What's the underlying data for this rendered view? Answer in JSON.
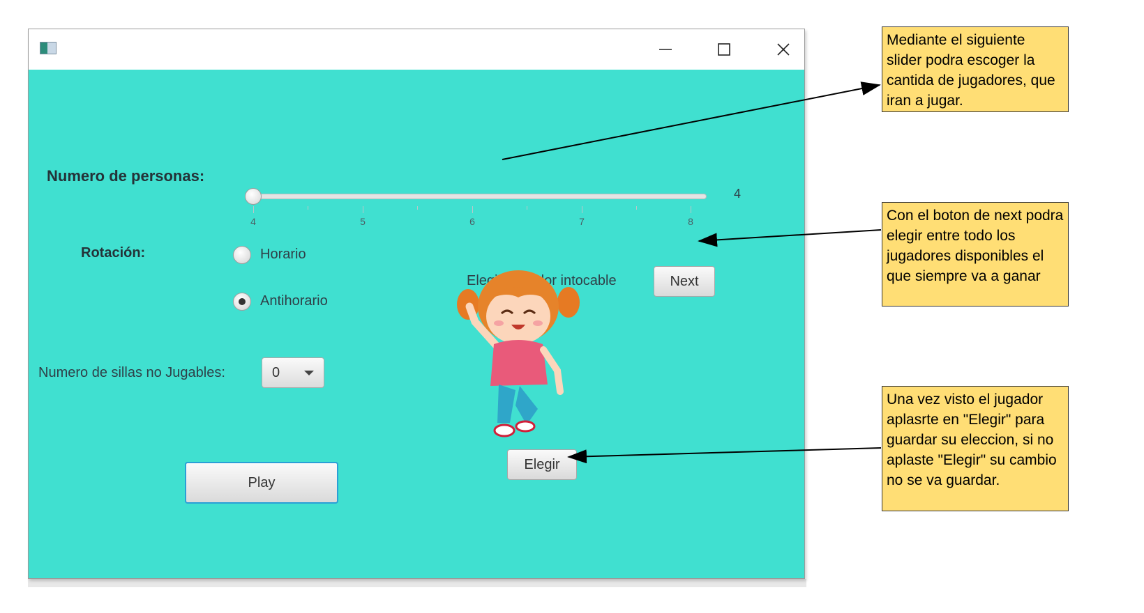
{
  "window": {
    "icon": "app-icon",
    "controls": [
      "minimize-icon",
      "maximize-icon",
      "close-icon"
    ]
  },
  "slider": {
    "label": "Numero de personas:",
    "value_text": "4",
    "value": 4,
    "min": 4,
    "max": 8,
    "tick_labels": [
      "4",
      "5",
      "6",
      "7",
      "8"
    ]
  },
  "rotation": {
    "label": "Rotación:",
    "options": [
      {
        "label": "Horario",
        "selected": false
      },
      {
        "label": "Antihorario",
        "selected": true
      }
    ]
  },
  "sillas": {
    "label": "Numero de sillas no Jugables:",
    "selected": "0"
  },
  "player": {
    "label": "Elegir Jugador intocable",
    "next_label": "Next",
    "choose_label": "Elegir",
    "image": "cartoon-girl-player"
  },
  "play_label": "Play",
  "notes": [
    "Mediante el siguiente slider podra escoger la cantida de jugadores, que iran a jugar.",
    "Con el boton de next podra elegir entre todo los jugadores disponibles el que siempre va a ganar",
    "Una vez visto el jugador aplasrte en \"Elegir\" para guardar su eleccion, si no aplaste \"Elegir\" su cambio no se va guardar."
  ],
  "colors": {
    "window_bg": "#40e0d0",
    "note_bg": "#ffde75"
  }
}
